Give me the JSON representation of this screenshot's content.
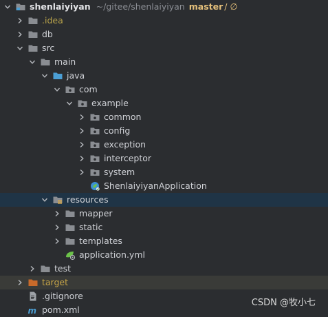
{
  "project": {
    "name": "shenlaiyiyan",
    "path": "~/gitee/shenlaiyiyan",
    "branch": "master",
    "branch_suffix": "/ ∅"
  },
  "tree": {
    "idea": ".idea",
    "db": "db",
    "src": "src",
    "main": "main",
    "java": "java",
    "com": "com",
    "example": "example",
    "common": "common",
    "config": "config",
    "exception": "exception",
    "interceptor": "interceptor",
    "system": "system",
    "app_class": "ShenlaiyiyanApplication",
    "resources": "resources",
    "mapper": "mapper",
    "static": "static",
    "templates": "templates",
    "application_yml": "application.yml",
    "test": "test",
    "target": "target",
    "gitignore": ".gitignore",
    "pom": "pom.xml"
  },
  "watermark": "CSDN @牧小七",
  "colors": {
    "background": "#2b2d30",
    "selected_row": "#1f3446",
    "excluded_row": "#3a3b38",
    "folder": "#8a8d92",
    "source_folder": "#4b9fd5",
    "excluded_folder": "#c86a2a",
    "branch": "#e5c07b"
  }
}
